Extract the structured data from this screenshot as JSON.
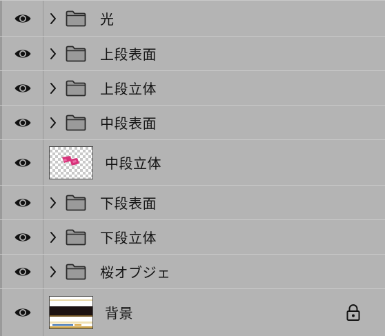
{
  "panel": {
    "name": "layers-panel",
    "colors": {
      "row_background": "#b4b4b4",
      "row_separator": "#cacaca",
      "icon": "#121212",
      "folder_fill": "#9a9a9a",
      "folder_stroke": "#2a2a2a",
      "artwork_pink": "#d8327a"
    },
    "layers": [
      {
        "name": "光",
        "kind": "group",
        "visible": true,
        "icon": "folder-icon",
        "visibility_icon": "eye-icon",
        "expand_icon": "chevron-right-icon"
      },
      {
        "name": "上段表面",
        "kind": "group",
        "visible": true,
        "icon": "folder-icon",
        "visibility_icon": "eye-icon",
        "expand_icon": "chevron-right-icon"
      },
      {
        "name": "上段立体",
        "kind": "group",
        "visible": true,
        "icon": "folder-icon",
        "visibility_icon": "eye-icon",
        "expand_icon": "chevron-right-icon"
      },
      {
        "name": "中段表面",
        "kind": "group",
        "visible": true,
        "icon": "folder-icon",
        "visibility_icon": "eye-icon",
        "expand_icon": "chevron-right-icon"
      },
      {
        "name": "中段立体",
        "kind": "layer",
        "visible": true,
        "thumbnail": "transparent-pink-shapes",
        "visibility_icon": "eye-icon"
      },
      {
        "name": "下段表面",
        "kind": "group",
        "visible": true,
        "icon": "folder-icon",
        "visibility_icon": "eye-icon",
        "expand_icon": "chevron-right-icon"
      },
      {
        "name": "下段立体",
        "kind": "group",
        "visible": true,
        "icon": "folder-icon",
        "visibility_icon": "eye-icon",
        "expand_icon": "chevron-right-icon"
      },
      {
        "name": "桜オブジェ",
        "kind": "group",
        "visible": true,
        "icon": "folder-icon",
        "visibility_icon": "eye-icon",
        "expand_icon": "chevron-right-icon"
      },
      {
        "name": "背景",
        "kind": "background",
        "visible": true,
        "thumbnail": "background-image",
        "locked": true,
        "visibility_icon": "eye-icon",
        "lock_icon": "lock-icon"
      }
    ]
  }
}
